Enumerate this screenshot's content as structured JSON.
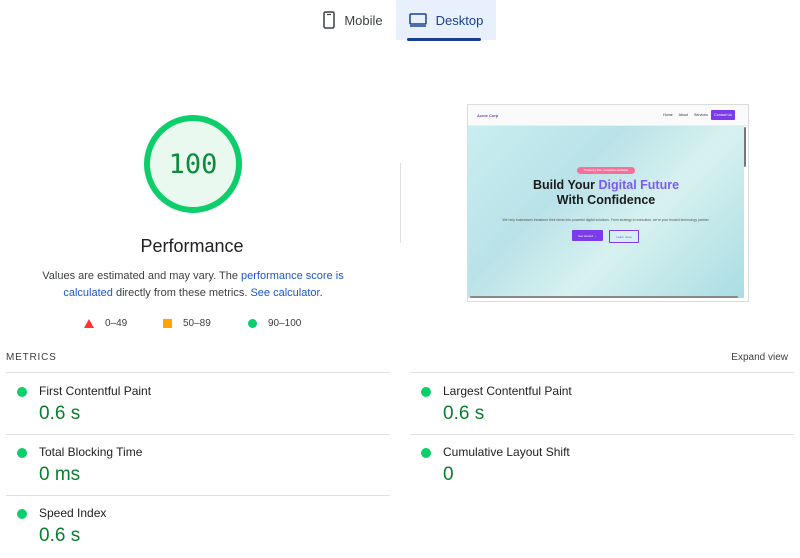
{
  "tabs": [
    {
      "label": "Mobile",
      "icon": "phone-icon",
      "selected": false
    },
    {
      "label": "Desktop",
      "icon": "monitor-icon",
      "selected": true
    }
  ],
  "score": {
    "value": "100",
    "title": "Performance",
    "desc_part1": "Values are estimated and may vary. The ",
    "desc_link1": "performance score is calculated",
    "desc_part2": " directly from these metrics. ",
    "desc_link2": "See calculator",
    "desc_part3": ".",
    "color": "#0cce6b"
  },
  "legend": [
    {
      "label": "0–49",
      "shape": "triangle",
      "color": "#ff3333"
    },
    {
      "label": "50–89",
      "shape": "square",
      "color": "#ffa400"
    },
    {
      "label": "90–100",
      "shape": "circle",
      "color": "#0cce6b"
    }
  ],
  "screenshot": {
    "logo": "Acme Corp",
    "nav_links": [
      "Home",
      "About",
      "Services"
    ],
    "nav_cta": "Contact Us",
    "badge": "Trusted by 500+ companies worldwide",
    "headline_part1": "Build Your ",
    "headline_accent": "Digital Future",
    "headline_part2": "With Confidence",
    "subtext": "We help businesses transform their ideas into powerful digital solutions. From strategy to execution, we're your trusted technology partner.",
    "btn_primary": "Get started →",
    "btn_secondary": "Learn more"
  },
  "metrics": {
    "header": "METRICS",
    "expand_label": "Expand view",
    "items": [
      {
        "label": "First Contentful Paint",
        "value": "0.6 s"
      },
      {
        "label": "Largest Contentful Paint",
        "value": "0.6 s"
      },
      {
        "label": "Total Blocking Time",
        "value": "0 ms"
      },
      {
        "label": "Cumulative Layout Shift",
        "value": "0"
      },
      {
        "label": "Speed Index",
        "value": "0.6 s"
      }
    ]
  }
}
